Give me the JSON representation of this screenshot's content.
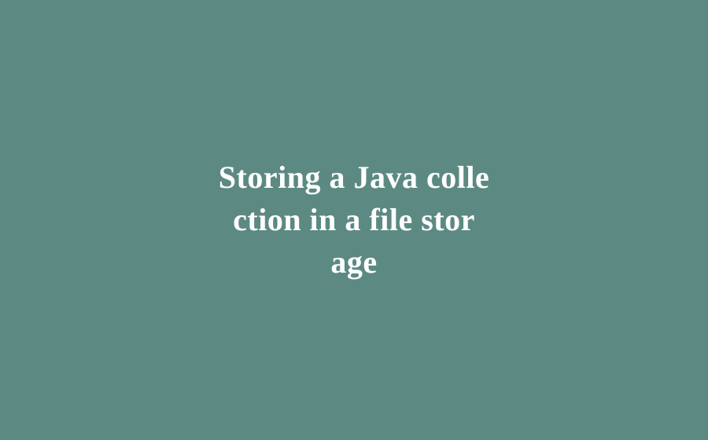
{
  "main": {
    "title_line1": "Storing a Java colle",
    "title_line2": "ction in a file stor",
    "title_line3": "age"
  }
}
